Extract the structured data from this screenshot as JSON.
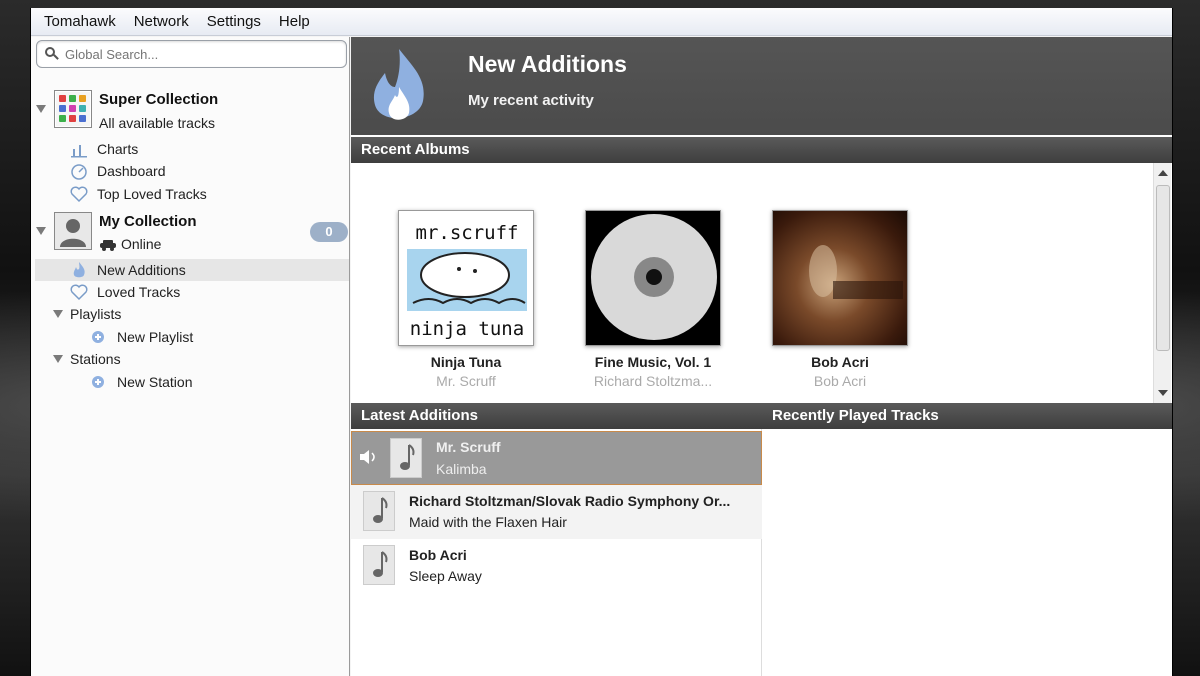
{
  "menu": [
    "Tomahawk",
    "Network",
    "Settings",
    "Help"
  ],
  "search": {
    "placeholder": "Global Search..."
  },
  "sidebar": {
    "super_collection": {
      "title": "Super Collection",
      "subtitle": "All available tracks"
    },
    "super_items": [
      {
        "label": "Charts",
        "icon": "chart-icon"
      },
      {
        "label": "Dashboard",
        "icon": "dashboard-icon"
      },
      {
        "label": "Top Loved Tracks",
        "icon": "heart-icon"
      }
    ],
    "my_collection": {
      "title": "My Collection",
      "status": "Online",
      "badge": "0"
    },
    "my_items": [
      {
        "label": "New Additions",
        "icon": "flame-icon",
        "selected": true
      },
      {
        "label": "Loved Tracks",
        "icon": "heart-icon"
      }
    ],
    "playlists": {
      "label": "Playlists",
      "new_label": "New Playlist"
    },
    "stations": {
      "label": "Stations",
      "new_label": "New Station"
    }
  },
  "banner": {
    "title": "New Additions",
    "subtitle": "My recent activity"
  },
  "sections": {
    "recent_albums": "Recent Albums",
    "latest_additions": "Latest Additions",
    "recently_played": "Recently Played Tracks"
  },
  "albums": [
    {
      "title": "Ninja Tuna",
      "artist": "Mr. Scruff",
      "cover_top": "mr.scruff",
      "cover_bottom": "ninja tuna"
    },
    {
      "title": "Fine Music, Vol. 1",
      "artist": "Richard Stoltzma..."
    },
    {
      "title": "Bob Acri",
      "artist": "Bob Acri"
    }
  ],
  "tracks": [
    {
      "artist": "Mr. Scruff",
      "title": "Kalimba",
      "playing": true
    },
    {
      "artist": "Richard Stoltzman/Slovak Radio Symphony Or...",
      "title": "Maid with the Flaxen Hair"
    },
    {
      "artist": "Bob Acri",
      "title": "Sleep Away"
    }
  ],
  "colors": {
    "banner": "#4f4f4f",
    "badge": "#9db0c8",
    "flame": "#8fb0e0",
    "playing_row": "#999999"
  }
}
